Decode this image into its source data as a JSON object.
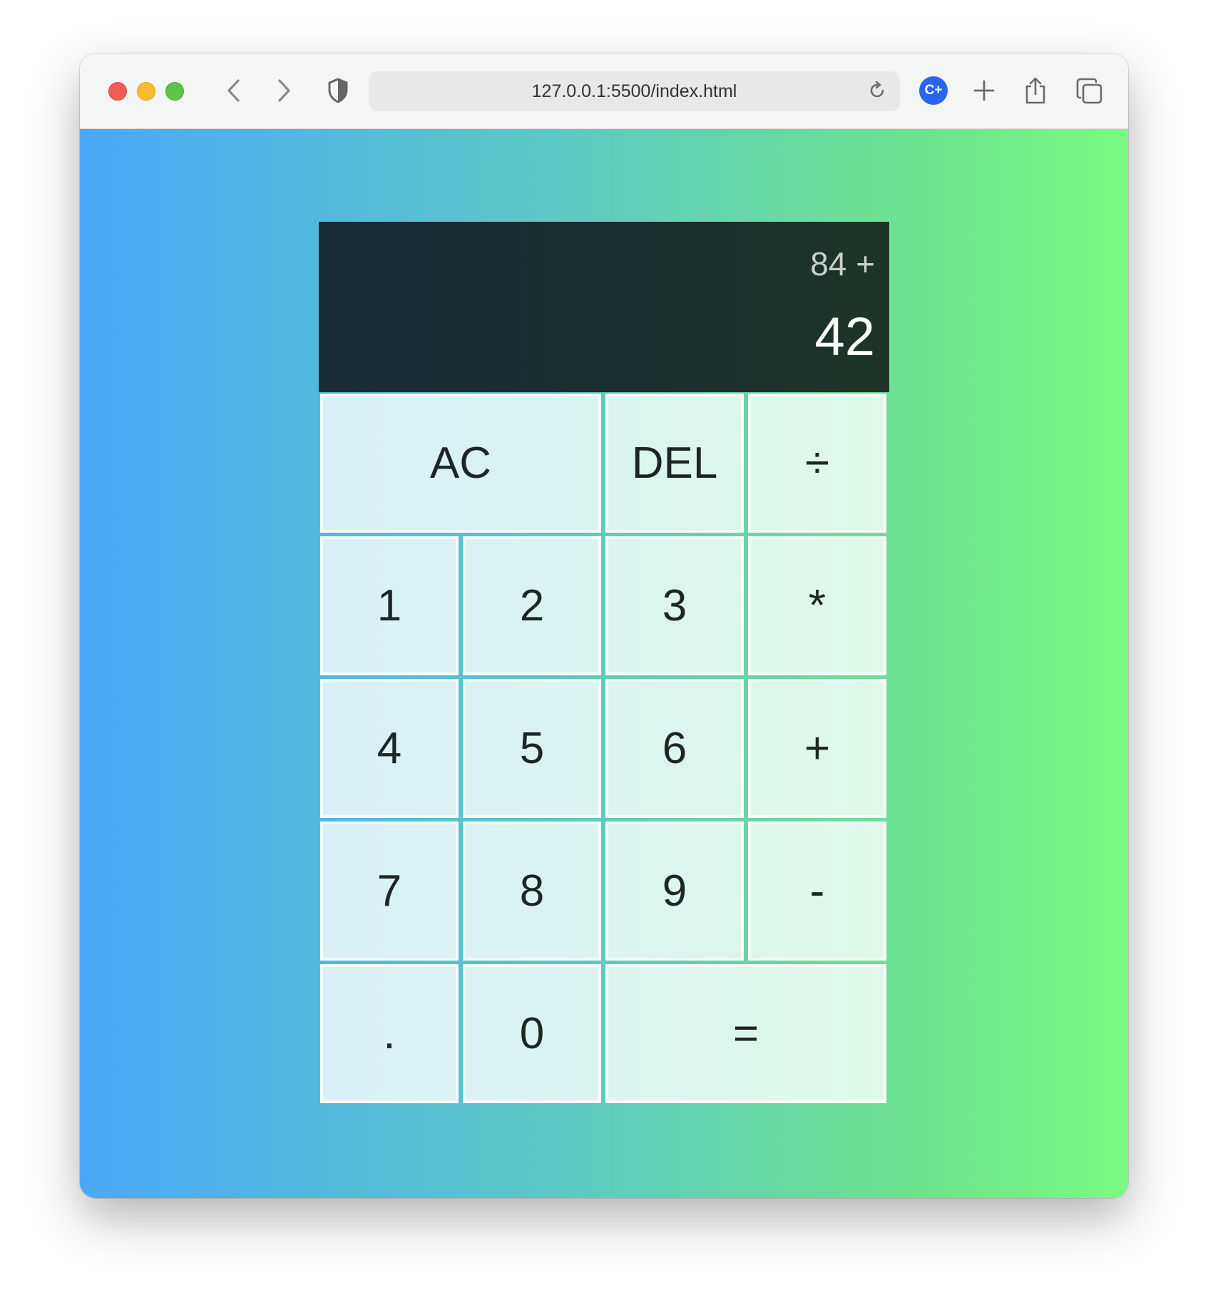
{
  "browser": {
    "url": "127.0.0.1:5500/index.html",
    "icons": {
      "back": "chevron-left-icon",
      "forward": "chevron-right-icon",
      "privacy": "shield-icon",
      "reload": "reload-icon",
      "extension": "c-plus-extension-icon",
      "new_tab": "plus-icon",
      "share": "share-icon",
      "tabs": "tab-overview-icon"
    },
    "extension_label": "C+"
  },
  "calculator": {
    "previous_operand": "84 +",
    "current_operand": "42",
    "keys": {
      "ac": "AC",
      "del": "DEL",
      "divide": "÷",
      "one": "1",
      "two": "2",
      "three": "3",
      "multiply": "*",
      "four": "4",
      "five": "5",
      "six": "6",
      "plus": "+",
      "seven": "7",
      "eight": "8",
      "nine": "9",
      "minus": "-",
      "decimal": ".",
      "zero": "0",
      "equals": "="
    }
  },
  "colors": {
    "gradient_start": "#4ba8f8",
    "gradient_end": "#7afa81",
    "display_background": "#162b36"
  }
}
